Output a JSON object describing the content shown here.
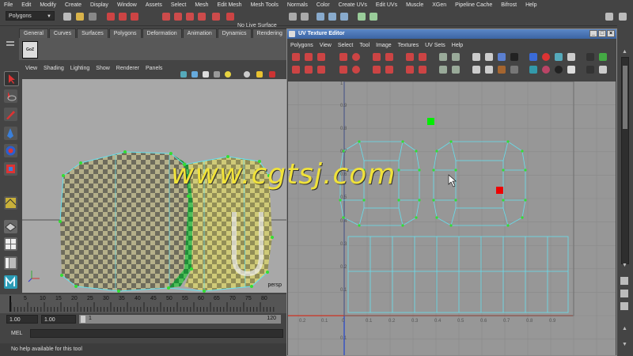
{
  "menubar": {
    "items": [
      "File",
      "Edit",
      "Modify",
      "Create",
      "Display",
      "Window",
      "Assets",
      "Select",
      "Mesh",
      "Edit Mesh",
      "Mesh Tools",
      "Normals",
      "Color",
      "Create UVs",
      "Edit UVs",
      "Muscle",
      "XGen",
      "Pipeline Cache",
      "Bifrost",
      "Help"
    ]
  },
  "statusline": {
    "mode_dropdown": "Polygons",
    "live_surface": "No Live Surface"
  },
  "shelf": {
    "tabs": [
      "General",
      "Curves",
      "Surfaces",
      "Polygons",
      "Deformation",
      "Animation",
      "Dynamics",
      "Rendering"
    ],
    "goz_label": "GoZ"
  },
  "viewport": {
    "menu": [
      "View",
      "Shading",
      "Lighting",
      "Show",
      "Renderer",
      "Panels"
    ],
    "camera_label": "persp"
  },
  "timeline": {
    "ticks": [
      "5",
      "10",
      "15",
      "20",
      "25",
      "30",
      "35",
      "40",
      "45",
      "50",
      "55",
      "60",
      "65",
      "70",
      "75",
      "80"
    ],
    "frame": "1"
  },
  "range": {
    "start": "1.00",
    "current": "1.00",
    "slider_start": "1",
    "end": "120"
  },
  "commandline": {
    "label": "MEL"
  },
  "helpline": {
    "text": "No help available for this tool"
  },
  "uv_editor": {
    "title": "UV Texture Editor",
    "menu": [
      "Polygons",
      "View",
      "Select",
      "Tool",
      "Image",
      "Textures",
      "UV Sets",
      "Help"
    ],
    "grid_labels_x": [
      "0.2",
      "0.1",
      "0",
      "0.1",
      "0.2",
      "0.3",
      "0.4",
      "0.5",
      "0.6",
      "0.7",
      "0.8",
      "0.9"
    ],
    "grid_labels_y": [
      "1",
      "0.9",
      "0.8",
      "0.7",
      "0.6",
      "0.5",
      "0.4",
      "0.3",
      "0.2",
      "0.1",
      "0.1"
    ]
  },
  "watermark": {
    "text": "www.cgtsj.com"
  },
  "colors": {
    "accent_title": "#4a76b8",
    "uv_edge": "#66e0ee",
    "uv_vertex": "#33dd33",
    "green_marker": "#00ee00",
    "red_marker": "#ee0000",
    "watermark": "#f0e23a"
  }
}
